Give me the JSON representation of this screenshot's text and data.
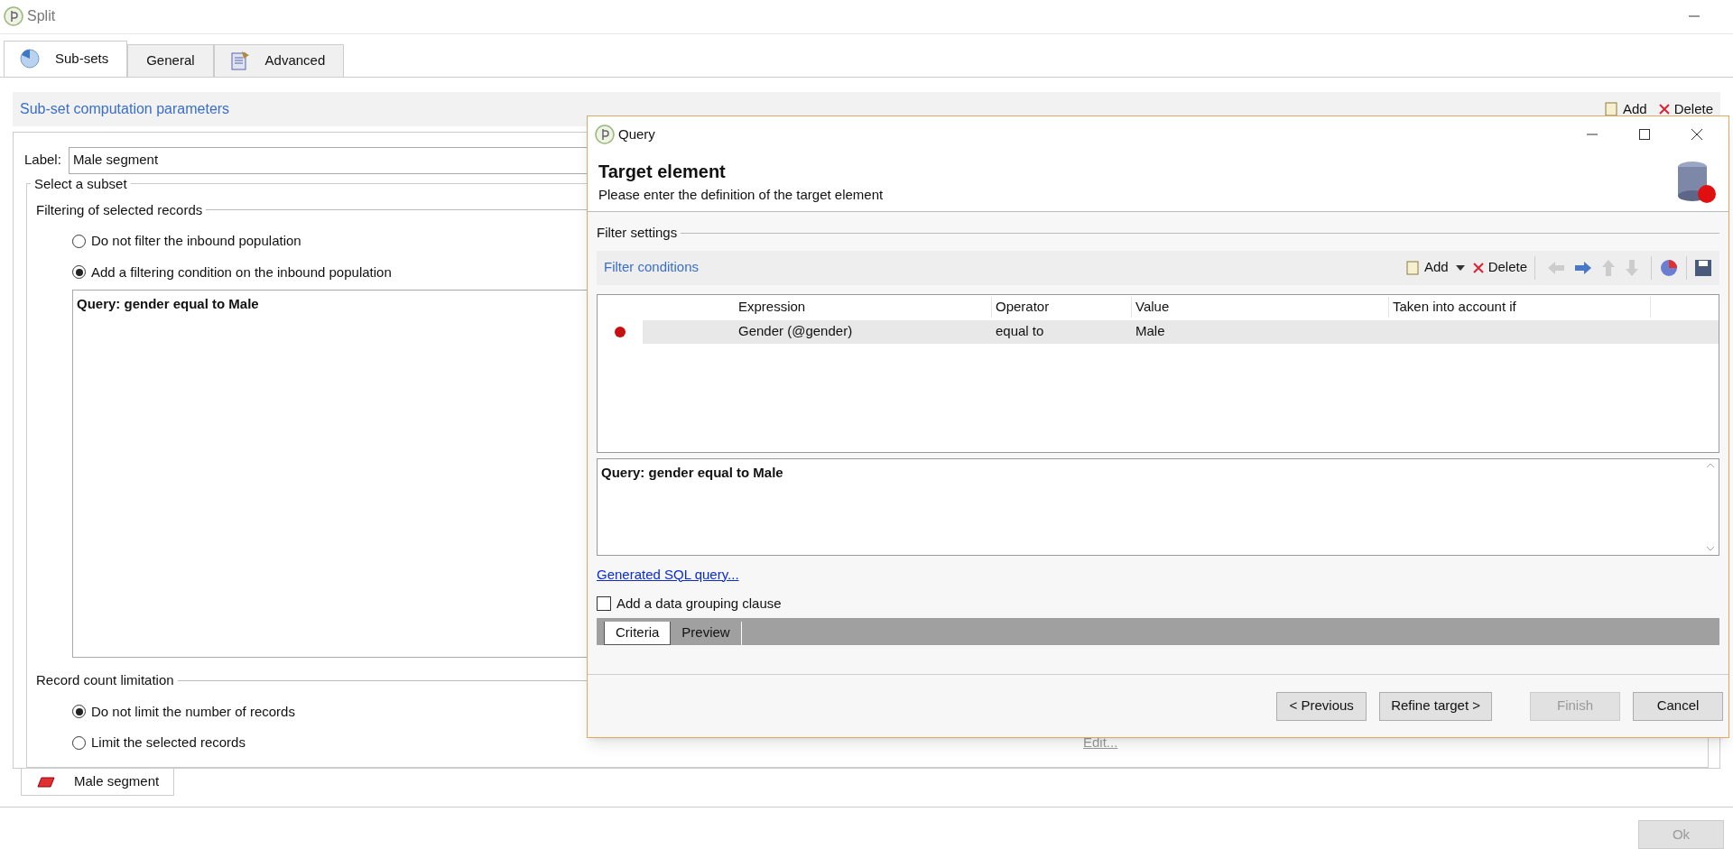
{
  "window": {
    "title": "Split"
  },
  "tabs": [
    {
      "label": "Sub-sets",
      "selected": true
    },
    {
      "label": "General",
      "selected": false
    },
    {
      "label": "Advanced",
      "selected": false
    }
  ],
  "section_header": {
    "title": "Sub-set computation parameters",
    "toolbar": [
      "Add",
      "Delete"
    ]
  },
  "label_field": {
    "label": "Label:",
    "value": "Male segment"
  },
  "subset_group": {
    "title": "Select a subset",
    "filtering": {
      "title": "Filtering of selected records",
      "options": [
        {
          "label": "Do not filter the inbound population",
          "selected": false
        },
        {
          "label": "Add a filtering condition on the inbound population",
          "selected": true
        }
      ],
      "query_text": "Query: gender equal to Male"
    },
    "record_limit": {
      "title": "Record count limitation",
      "options": [
        {
          "label": "Do not limit the number of records",
          "selected": true
        },
        {
          "label": "Limit the selected records",
          "selected": false
        }
      ],
      "edit_link": {
        "label": "Edit...",
        "disabled": true
      }
    }
  },
  "bottom_tabs": [
    {
      "label": "Male segment",
      "selected": true
    }
  ],
  "ok_button": {
    "label": "Ok",
    "disabled": true
  },
  "query_dialog": {
    "title": "Query",
    "header_title": "Target element",
    "header_subtitle": "Please enter the definition of the target element",
    "filter_settings": "Filter settings",
    "filter_conditions": "Filter conditions",
    "toolbar": {
      "add": "Add",
      "delete": "Delete"
    },
    "table": {
      "columns": [
        "Expression",
        "Operator",
        "Value",
        "Taken into account if"
      ],
      "rows": [
        {
          "cells": [
            "Gender (@gender)",
            "equal to",
            "Male",
            ""
          ],
          "selected": true
        }
      ]
    },
    "query_text": "Query: gender equal to Male",
    "sql_link": "Generated SQL query...",
    "grouping": {
      "label": "Add a data grouping clause",
      "checked": false
    },
    "tabs": [
      {
        "label": "Criteria",
        "selected": true
      },
      {
        "label": "Preview",
        "selected": false
      }
    ],
    "buttons": [
      {
        "label": "< Previous",
        "disabled": false
      },
      {
        "label": "Refine target >",
        "disabled": false
      },
      {
        "label": "Finish",
        "disabled": true
      },
      {
        "label": "Cancel",
        "disabled": false
      }
    ]
  }
}
